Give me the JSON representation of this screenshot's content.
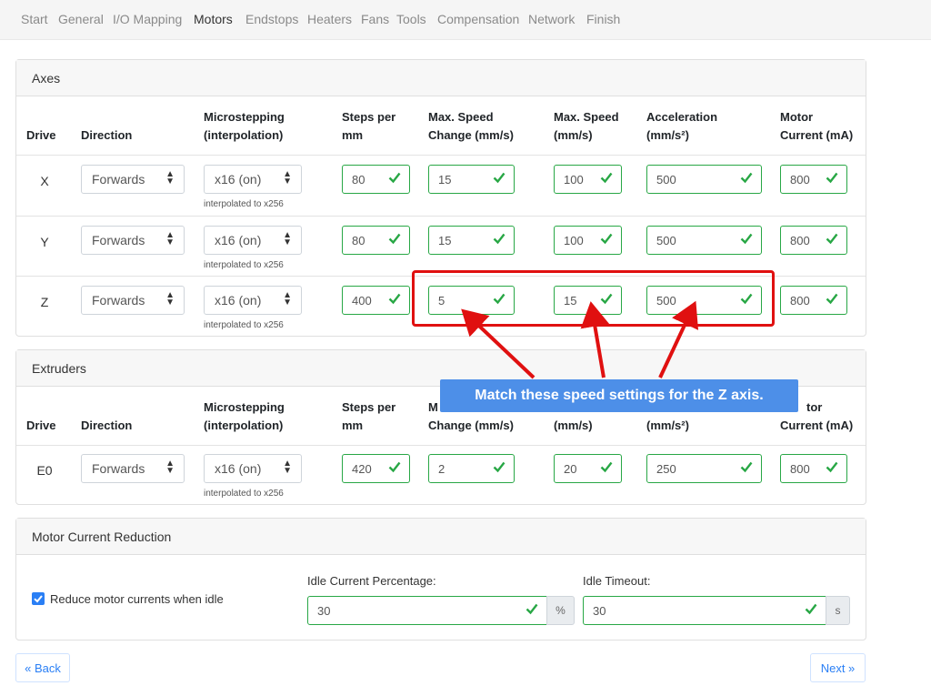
{
  "nav": {
    "items": [
      "Start",
      "General",
      "I/O Mapping",
      "Motors",
      "Endstops",
      "Heaters",
      "Fans",
      "Tools",
      "Compensation",
      "Network",
      "Finish"
    ],
    "active": "Motors"
  },
  "axes": {
    "title": "Axes",
    "headers": {
      "drive": "Drive",
      "direction": "Direction",
      "micro_1": "Microstepping",
      "micro_2": "(interpolation)",
      "steps_1": "Steps per",
      "steps_2": "mm",
      "maxchg_1": "Max. Speed",
      "maxchg_2": "Change (mm/s)",
      "maxspd_1": "Max. Speed",
      "maxspd_2": "(mm/s)",
      "accel_1": "Acceleration",
      "accel_2": "(mm/s²)",
      "current_1": "Motor",
      "current_2": "Current (mA)"
    },
    "rows": [
      {
        "drive": "X",
        "direction": "Forwards",
        "microstep": "x16 (on)",
        "hint": "interpolated to x256",
        "steps": "80",
        "max_change": "15",
        "max_speed": "100",
        "accel": "500",
        "current": "800"
      },
      {
        "drive": "Y",
        "direction": "Forwards",
        "microstep": "x16 (on)",
        "hint": "interpolated to x256",
        "steps": "80",
        "max_change": "15",
        "max_speed": "100",
        "accel": "500",
        "current": "800"
      },
      {
        "drive": "Z",
        "direction": "Forwards",
        "microstep": "x16 (on)",
        "hint": "interpolated to x256",
        "steps": "400",
        "max_change": "5",
        "max_speed": "15",
        "accel": "500",
        "current": "800"
      }
    ]
  },
  "extruders": {
    "title": "Extruders",
    "headers": {
      "drive": "Drive",
      "direction": "Direction",
      "micro_1": "Microstepping",
      "micro_2": "(interpolation)",
      "steps_1": "Steps per",
      "steps_2": "mm",
      "maxchg_1": "M",
      "maxchg_2": "Change (mm/s)",
      "maxspd_2": "(mm/s)",
      "accel_2": "(mm/s²)",
      "current_1": "tor",
      "current_2": "Current (mA)"
    },
    "rows": [
      {
        "drive": "E0",
        "direction": "Forwards",
        "microstep": "x16 (on)",
        "hint": "interpolated to x256",
        "steps": "420",
        "max_change": "2",
        "max_speed": "20",
        "accel": "250",
        "current": "800"
      }
    ]
  },
  "reduction": {
    "title": "Motor Current Reduction",
    "checkbox_label": "Reduce motor currents when idle",
    "checked": true,
    "idle_pct_label": "Idle Current Percentage:",
    "idle_pct_value": "30",
    "idle_pct_unit": "%",
    "idle_timeout_label": "Idle Timeout:",
    "idle_timeout_value": "30",
    "idle_timeout_unit": "s"
  },
  "buttons": {
    "back": "« Back",
    "next": "Next »"
  },
  "annotation": {
    "callout": "Match these speed settings for the Z axis."
  },
  "colors": {
    "valid": "#28a745",
    "accent": "#2a7ff5",
    "highlight": "#e01010",
    "callout_bg": "#4d8fe8"
  }
}
